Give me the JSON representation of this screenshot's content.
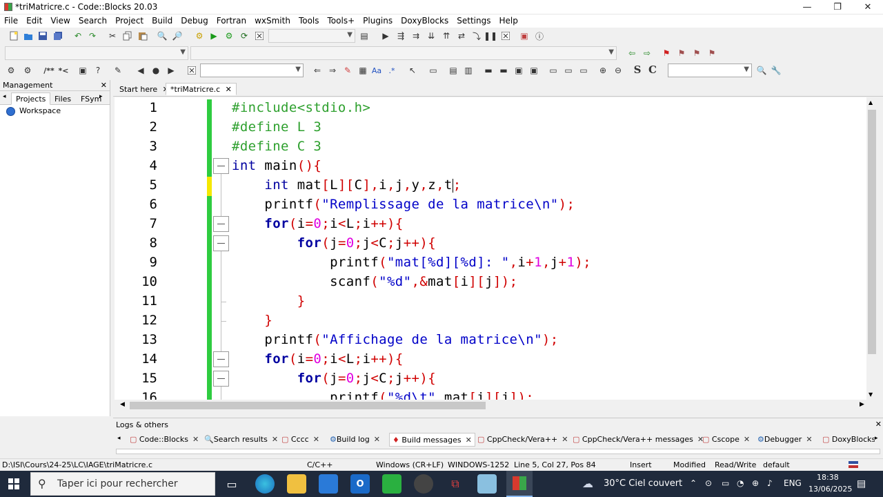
{
  "window": {
    "title": "*triMatricre.c - Code::Blocks 20.03",
    "min": "—",
    "max": "❐",
    "close": "✕"
  },
  "menu": [
    "File",
    "Edit",
    "View",
    "Search",
    "Project",
    "Build",
    "Debug",
    "Fortran",
    "wxSmith",
    "Tools",
    "Tools+",
    "Plugins",
    "DoxyBlocks",
    "Settings",
    "Help"
  ],
  "management": {
    "title": "Management",
    "close": "✕",
    "tabs": [
      "Projects",
      "Files",
      "FSym"
    ],
    "tree_root": "Workspace"
  },
  "editor_tabs": [
    {
      "label": "Start here",
      "close": "✕"
    },
    {
      "label": "*triMatricre.c",
      "close": "✕"
    }
  ],
  "line_numbers": [
    "1",
    "2",
    "3",
    "4",
    "5",
    "6",
    "7",
    "8",
    "9",
    "10",
    "11",
    "12",
    "13",
    "14",
    "15",
    "16"
  ],
  "code_lines": [
    "#include<stdio.h>",
    "#define L 3",
    "#define C 3",
    "int main(){",
    "    int mat[L][C],i,j,y,z,t;",
    "    printf(\"Remplissage de la matrice\\n\");",
    "    for(i=0;i<L;i++){",
    "        for(j=0;j<C;j++){",
    "            printf(\"mat[%d][%d]: \",i+1,j+1);",
    "            scanf(\"%d\",&mat[i][j]);",
    "        }",
    "    }",
    "    printf(\"Affichage de la matrice\\n\");",
    "    for(i=0;i<L;i++){",
    "        for(j=0;j<C;j++){",
    "            printf(\"%d\\t\",mat[i][j]);"
  ],
  "logs": {
    "title": "Logs & others",
    "close": "✕",
    "tabs": [
      "Code::Blocks",
      "Search results",
      "Cccc",
      "Build log",
      "Build messages",
      "CppCheck/Vera++",
      "CppCheck/Vera++ messages",
      "Cscope",
      "Debugger",
      "DoxyBlocks"
    ]
  },
  "status": {
    "path": "D:\\ISI\\Cours\\24-25\\LC\\IAGE\\triMatricre.c",
    "lang": "C/C++",
    "eol": "Windows (CR+LF)",
    "enc": "WINDOWS-1252",
    "pos": "Line 5, Col 27, Pos 84",
    "mode": "Insert",
    "modified": "Modified",
    "rw": "Read/Write",
    "profile": "default"
  },
  "taskbar": {
    "search_placeholder": "Taper ici pour rechercher",
    "weather": "30°C  Ciel couvert",
    "lang": "ENG",
    "time": "18:38",
    "date": "13/06/2025"
  }
}
